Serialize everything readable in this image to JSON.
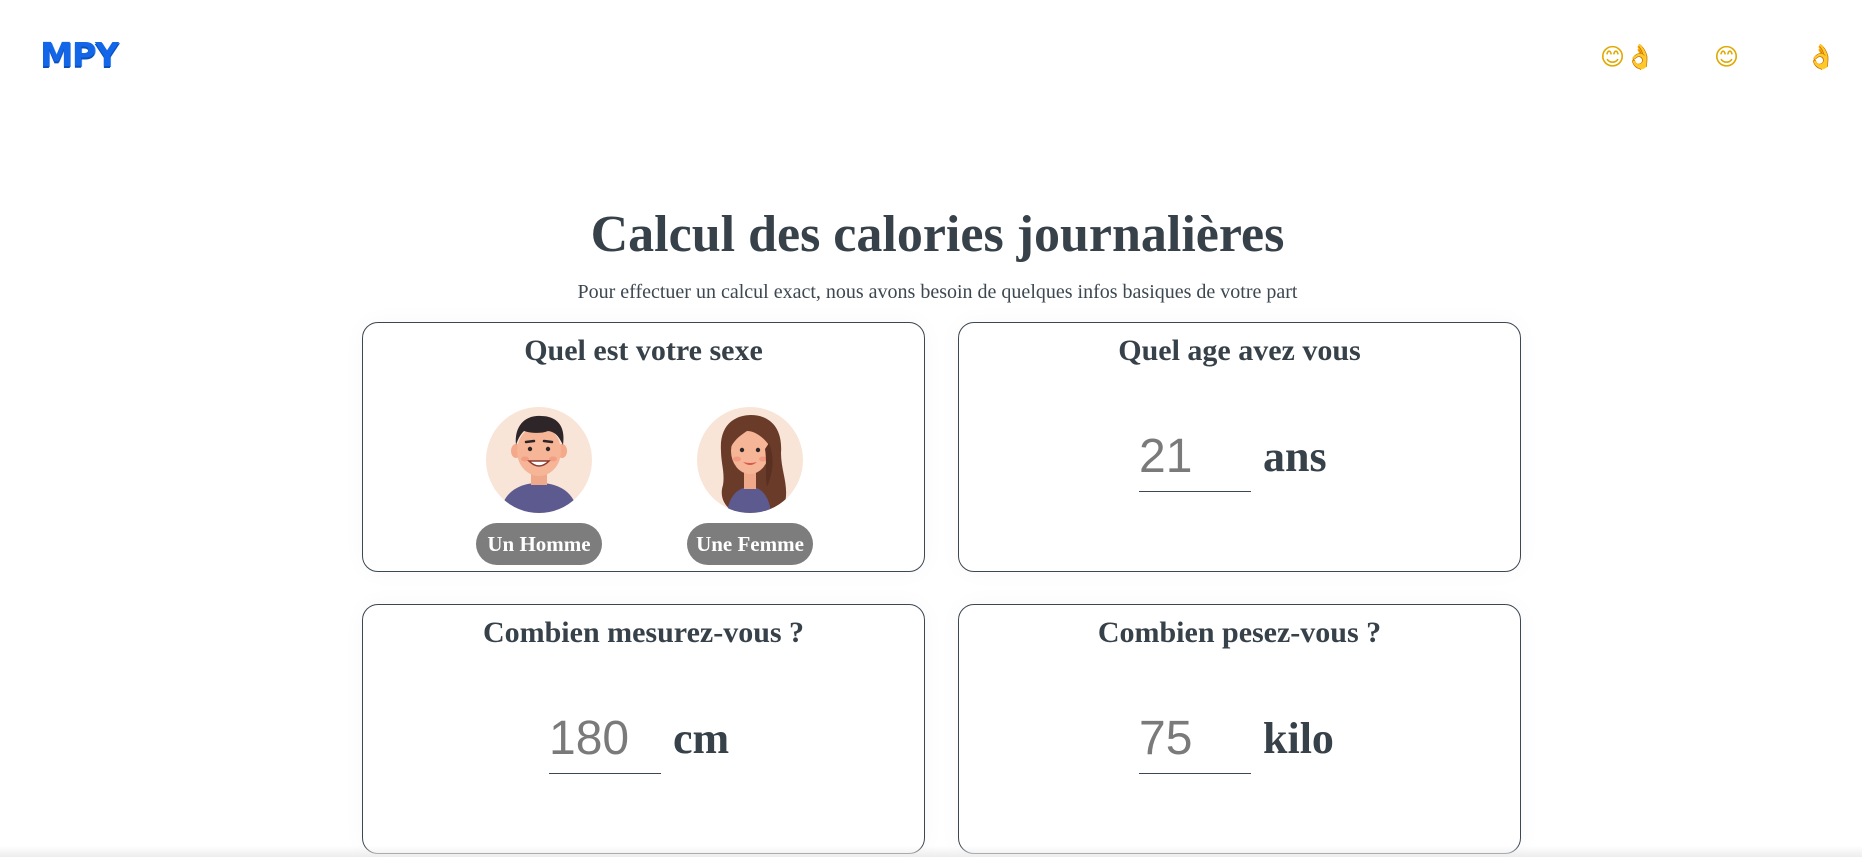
{
  "header": {
    "logo_text": "MPY",
    "nav": [
      {
        "label": "😊👌",
        "icon": "smile-ok-icon"
      },
      {
        "label": "😊",
        "icon": "smile-icon"
      },
      {
        "label": "👌",
        "icon": "ok-hand-icon"
      }
    ]
  },
  "main": {
    "title": "Calcul des calories journalières",
    "subtitle": "Pour effectuer un calcul exact, nous avons besoin de quelques infos basiques de votre part"
  },
  "sex_card": {
    "question": "Quel est votre sexe",
    "options": [
      {
        "label": "Un Homme",
        "avatar": "man-avatar"
      },
      {
        "label": "Une Femme",
        "avatar": "woman-avatar"
      }
    ]
  },
  "age_card": {
    "question": "Quel age avez vous",
    "placeholder": "21",
    "unit": "ans"
  },
  "height_card": {
    "question": "Combien mesurez-vous ?",
    "placeholder": "180",
    "unit": "cm"
  },
  "weight_card": {
    "question": "Combien pesez-vous ?",
    "placeholder": "75",
    "unit": "kilo"
  },
  "colors": {
    "logo": "#1366e8",
    "text": "#374149",
    "button_bg": "#7d7d7d",
    "avatar_bg": "#f9e5d8"
  }
}
